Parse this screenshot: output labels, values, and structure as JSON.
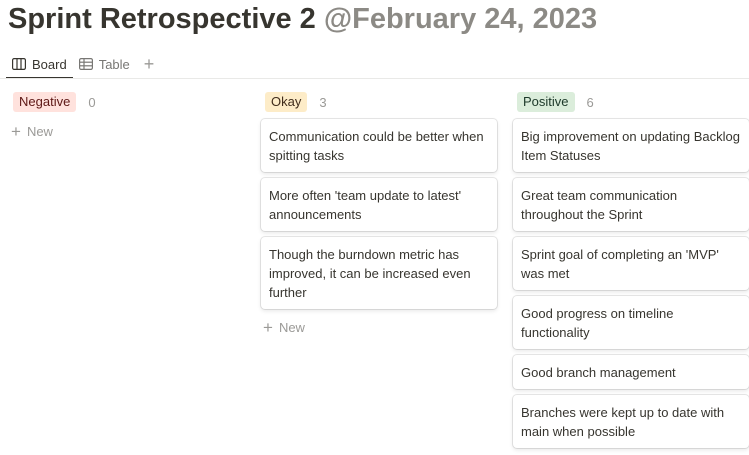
{
  "page": {
    "title": "Sprint Retrospective 2",
    "date_mention": "@February 24, 2023"
  },
  "tabs": [
    {
      "label": "Board",
      "icon": "board-icon",
      "active": true
    },
    {
      "label": "Table",
      "icon": "table-icon",
      "active": false
    }
  ],
  "add_view_icon": "plus-icon",
  "columns": [
    {
      "label": "Negative",
      "count": "0",
      "tag_bg": "#ffe2dd",
      "tag_fg": "#5d1715",
      "cards": [],
      "new_label": "New"
    },
    {
      "label": "Okay",
      "count": "3",
      "tag_bg": "#fdecc8",
      "tag_fg": "#402c1b",
      "cards": [
        "Communication could be better when spitting tasks",
        "More often 'team update to latest' announcements",
        "Though the burndown metric has improved, it can be increased even further"
      ],
      "new_label": "New"
    },
    {
      "label": "Positive",
      "count": "6",
      "tag_bg": "#dbeddb",
      "tag_fg": "#1c3829",
      "cards": [
        "Big improvement on updating Backlog Item Statuses",
        "Great team communication throughout the Sprint",
        "Sprint goal of completing an 'MVP' was met",
        "Good progress on timeline functionality",
        "Good branch management",
        "Branches were kept up to date with main when possible"
      ],
      "new_label": ""
    }
  ]
}
